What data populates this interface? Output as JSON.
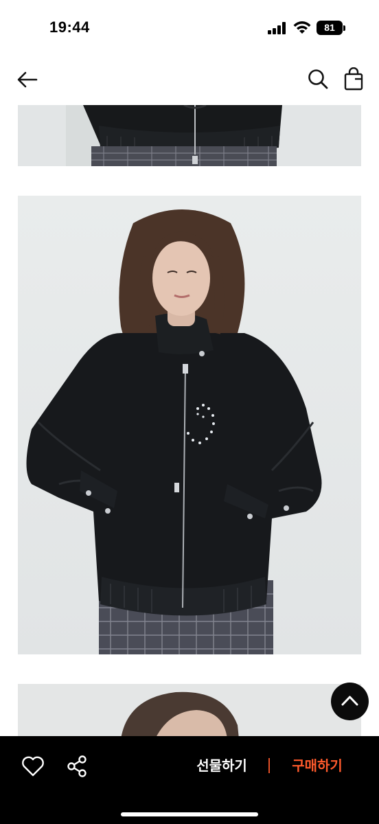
{
  "status_bar": {
    "time": "19:44",
    "battery": "81",
    "icons": [
      "signal-icon",
      "wifi-icon",
      "battery-icon"
    ]
  },
  "nav": {
    "icons": [
      "back-arrow-icon",
      "search-icon",
      "shopping-bag-icon"
    ]
  },
  "images": [
    "product-photo-top",
    "product-photo-main",
    "product-photo-bottom"
  ],
  "scroll_top": {
    "icon": "chevron-up-icon"
  },
  "bottom_bar": {
    "like_icon": "heart-icon",
    "share_icon": "share-icon",
    "gift_label": "선물하기",
    "buy_label": "구매하기",
    "buy_color": "#ff5a2c"
  }
}
